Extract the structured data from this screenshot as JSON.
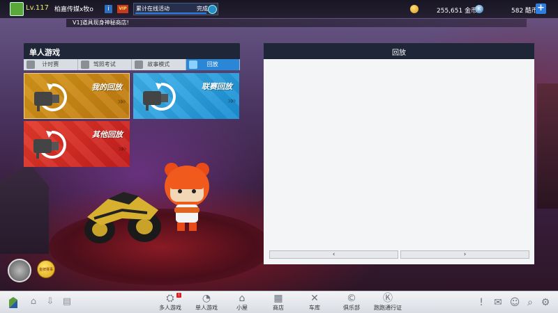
{
  "player": {
    "level": "Lv.117",
    "nickname": "柏嘉传媒x牧o",
    "info_icon": "i",
    "vip_label": "VIP"
  },
  "task": {
    "label": "累计在线活动",
    "status": "完成",
    "progress": 0.85
  },
  "currency": {
    "coins": "255,651 金币",
    "kcoins": "582 酷币",
    "kcoin_symbol": "K",
    "add_label": "+"
  },
  "ticker": {
    "text": "V1]道具现身神秘商店!"
  },
  "left_panel": {
    "title": "单人游戏",
    "tabs": [
      {
        "label": "计时赛",
        "icon": "stopwatch-icon"
      },
      {
        "label": "驾照考试",
        "icon": "car-license-icon"
      },
      {
        "label": "故事模式",
        "icon": "book-icon"
      },
      {
        "label": "回放",
        "icon": "replay-icon",
        "active": true
      }
    ],
    "cards": {
      "my_replay": "我的回放",
      "league_replay": "联赛回放",
      "other_replay": "其他回放"
    },
    "card_chevrons": "»»"
  },
  "right_panel": {
    "title": "回放",
    "prev_label": "‹",
    "next_label": "›"
  },
  "badges": {
    "gold_badge_text": "金牌赛事"
  },
  "bottom_nav": {
    "items": [
      {
        "label": "多人游戏",
        "icon": "multiplayer-icon",
        "glyph": "⛭",
        "notice": "!"
      },
      {
        "label": "单人游戏",
        "icon": "single-player-icon",
        "glyph": "◔"
      },
      {
        "label": "小屋",
        "icon": "house-icon",
        "glyph": "⌂"
      },
      {
        "label": "商店",
        "icon": "shop-icon",
        "glyph": "▦"
      },
      {
        "label": "车库",
        "icon": "garage-icon",
        "glyph": "✕"
      },
      {
        "label": "俱乐部",
        "icon": "club-icon",
        "glyph": "©"
      },
      {
        "label": "跑跑通行证",
        "icon": "pass-icon",
        "glyph": "Ⓚ"
      }
    ],
    "left_glyphs": [
      "⌂",
      "⇩",
      "▤"
    ],
    "right_glyphs": [
      "!",
      "✉",
      "☺",
      "⌕",
      "⚙"
    ]
  },
  "colors": {
    "accent_blue": "#2a86d6",
    "my_replay_card": "#d4961a",
    "league_replay_card": "#3fb3ea",
    "other_replay_card": "#e43a2a",
    "panel_header": "#1f2638"
  }
}
